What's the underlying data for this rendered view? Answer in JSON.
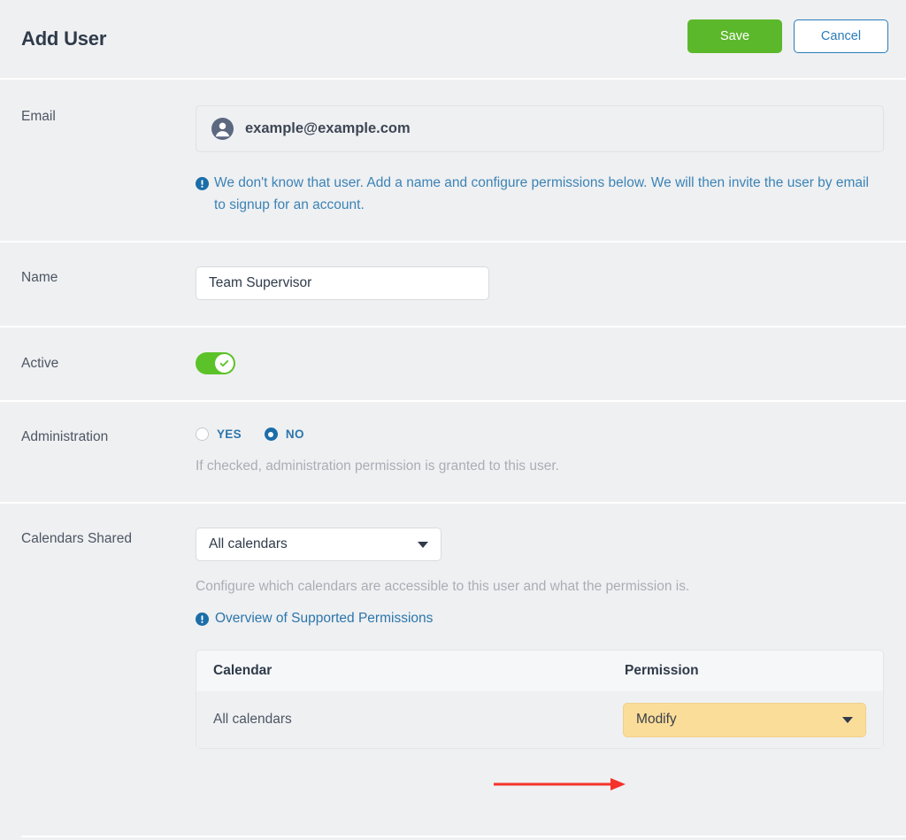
{
  "header": {
    "title": "Add User",
    "save_label": "Save",
    "cancel_label": "Cancel",
    "save_color": "#5cb82b",
    "cancel_color": "#2b7cb8"
  },
  "email": {
    "label": "Email",
    "value": "example@example.com",
    "icon": "user-avatar-icon",
    "note": "We don't know that user. Add a name and configure permissions below. We will then invite the user by email to signup for an account.",
    "note_icon": "info-exclamation-icon",
    "note_color": "#3b83b5"
  },
  "name": {
    "label": "Name",
    "value": "Team Supervisor",
    "placeholder": ""
  },
  "active": {
    "label": "Active",
    "toggle_state": "on",
    "toggle_color": "#5cc229",
    "knob_icon": "check-icon"
  },
  "administration": {
    "label": "Administration",
    "options": [
      {
        "label": "YES",
        "checked": false
      },
      {
        "label": "NO",
        "checked": true
      }
    ],
    "hint": "If checked, administration permission is granted to this user.",
    "accent_color": "#1b6ea8"
  },
  "calendars_shared": {
    "label": "Calendars Shared",
    "select_value": "All calendars",
    "select_options": [
      "All calendars"
    ],
    "hint": "Configure which calendars are accessible to this user and what the permission is.",
    "link_text": "Overview of Supported Permissions",
    "link_icon": "info-exclamation-icon",
    "table": {
      "columns": [
        "Calendar",
        "Permission"
      ],
      "rows": [
        {
          "calendar": "All calendars",
          "permission": "Modify"
        }
      ],
      "highlight_color": "#fbdd9a"
    }
  },
  "annotation": {
    "arrow_color": "#f5312a",
    "points_to": "permission-select"
  }
}
